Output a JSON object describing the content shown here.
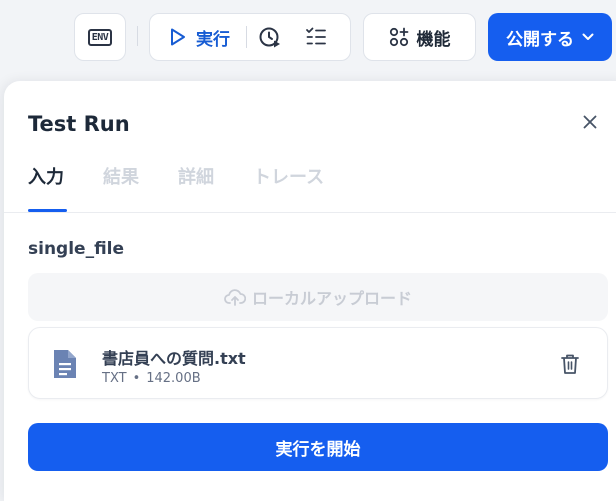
{
  "toolbar": {
    "env_label": "ENV",
    "run_label": "実行",
    "features_label": "機能",
    "publish_label": "公開する"
  },
  "panel": {
    "title": "Test Run",
    "tabs": [
      {
        "label": "入力",
        "active": true
      },
      {
        "label": "結果",
        "active": false
      },
      {
        "label": "詳細",
        "active": false
      },
      {
        "label": "トレース",
        "active": false
      }
    ],
    "field_label": "single_file",
    "upload_label": "ローカルアップロード",
    "file": {
      "name": "書店員への質問.txt",
      "type": "TXT",
      "separator": "•",
      "size": "142.00B"
    },
    "start_label": "実行を開始"
  },
  "colors": {
    "accent": "#155eef",
    "text_primary": "#1d2939",
    "tab_inactive": "#d0d5dd",
    "file_icon": "#6b83b3"
  },
  "icons": [
    "play-icon",
    "history-icon",
    "checklist-icon",
    "features-icon",
    "chevron-down-icon",
    "close-icon",
    "upload-cloud-icon",
    "file-icon",
    "trash-icon"
  ]
}
